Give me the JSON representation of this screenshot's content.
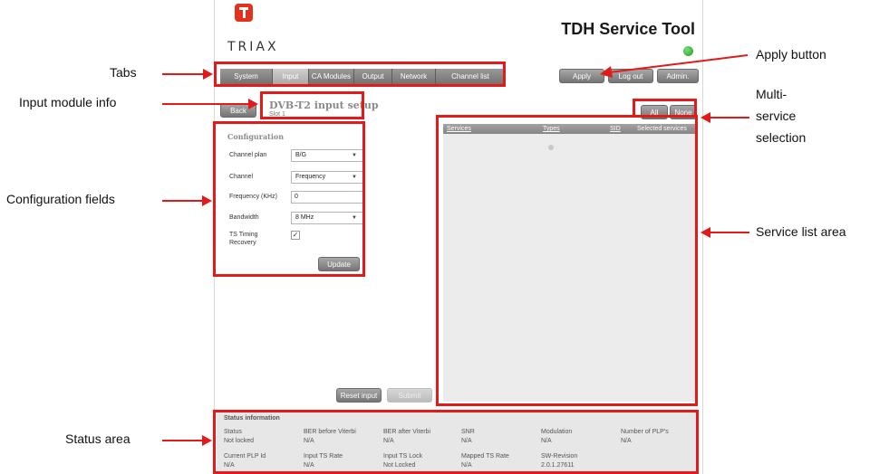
{
  "app": {
    "title": "TDH Service Tool",
    "logo_text": "TRIAX",
    "status_color": "#1a9a1a",
    "accent_color": "#e2311c"
  },
  "tabs": [
    {
      "label": "System",
      "active": false
    },
    {
      "label": "Input",
      "active": true
    },
    {
      "label": "CA Modules",
      "active": false
    },
    {
      "label": "Output",
      "active": false
    },
    {
      "label": "Network",
      "active": false
    },
    {
      "label": "Channel list",
      "active": false
    }
  ],
  "top_buttons": {
    "apply": "Apply",
    "logout": "Log out",
    "admin": "Admin."
  },
  "module": {
    "back": "Back",
    "title": "DVB-T2 input setup",
    "subtitle": "Slot 1"
  },
  "config": {
    "title": "Configuration",
    "channel_plan_label": "Channel plan",
    "channel_plan_value": "B/G",
    "channel_label": "Channel",
    "channel_value": "Frequency",
    "frequency_label": "Frequency (KHz)",
    "frequency_value": "0",
    "bandwidth_label": "Bandwidth",
    "bandwidth_value": "8 MHz",
    "ts_timing_label_1": "TS Timing",
    "ts_timing_label_2": "Recovery",
    "ts_timing_checked": "✓",
    "update": "Update"
  },
  "multi_select": {
    "all": "All",
    "none": "None"
  },
  "services": {
    "col_services": "Services",
    "col_types": "Types",
    "col_sid": "SID",
    "col_selected": "Selected services"
  },
  "actions": {
    "reset": "Reset input",
    "submit": "Submit"
  },
  "status": {
    "title": "Status information",
    "row1": [
      {
        "label": "Status",
        "value": "Not locked"
      },
      {
        "label": "BER before Viterbi",
        "value": "N/A"
      },
      {
        "label": "BER after Viterbi",
        "value": "N/A"
      },
      {
        "label": "SNR",
        "value": "N/A"
      },
      {
        "label": "Modulation",
        "value": "N/A"
      },
      {
        "label": "Number of PLP's",
        "value": "N/A"
      }
    ],
    "row2": [
      {
        "label": "Current PLP Id",
        "value": "N/A"
      },
      {
        "label": "Input TS Rate",
        "value": "N/A"
      },
      {
        "label": "Input TS Lock",
        "value": "Not Locked"
      },
      {
        "label": "Mapped TS Rate",
        "value": "N/A"
      },
      {
        "label": "SW-Revision",
        "value": "2.0.1.27611"
      }
    ]
  },
  "annotations": {
    "tabs": "Tabs",
    "input_module_info": "Input module info",
    "configuration_fields": "Configuration fields",
    "status_area": "Status area",
    "apply_button": "Apply button",
    "multi_line1": "Multi-",
    "multi_line2": "service",
    "multi_line3": "selection",
    "service_list_area": "Service list area",
    "color": "#e21a1a"
  }
}
